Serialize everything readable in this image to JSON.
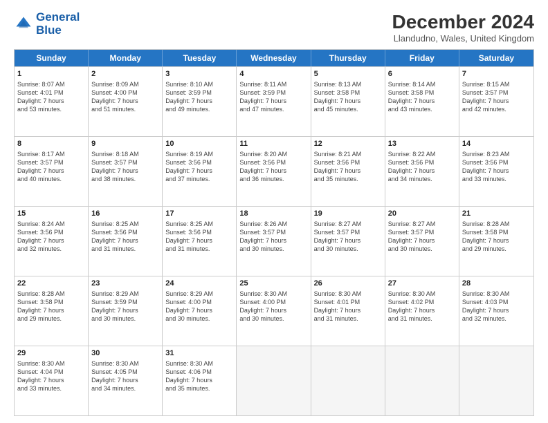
{
  "logo": {
    "line1": "General",
    "line2": "Blue"
  },
  "title": "December 2024",
  "subtitle": "Llandudno, Wales, United Kingdom",
  "header_days": [
    "Sunday",
    "Monday",
    "Tuesday",
    "Wednesday",
    "Thursday",
    "Friday",
    "Saturday"
  ],
  "weeks": [
    [
      {
        "day": "1",
        "lines": [
          "Sunrise: 8:07 AM",
          "Sunset: 4:01 PM",
          "Daylight: 7 hours",
          "and 53 minutes."
        ]
      },
      {
        "day": "2",
        "lines": [
          "Sunrise: 8:09 AM",
          "Sunset: 4:00 PM",
          "Daylight: 7 hours",
          "and 51 minutes."
        ]
      },
      {
        "day": "3",
        "lines": [
          "Sunrise: 8:10 AM",
          "Sunset: 3:59 PM",
          "Daylight: 7 hours",
          "and 49 minutes."
        ]
      },
      {
        "day": "4",
        "lines": [
          "Sunrise: 8:11 AM",
          "Sunset: 3:59 PM",
          "Daylight: 7 hours",
          "and 47 minutes."
        ]
      },
      {
        "day": "5",
        "lines": [
          "Sunrise: 8:13 AM",
          "Sunset: 3:58 PM",
          "Daylight: 7 hours",
          "and 45 minutes."
        ]
      },
      {
        "day": "6",
        "lines": [
          "Sunrise: 8:14 AM",
          "Sunset: 3:58 PM",
          "Daylight: 7 hours",
          "and 43 minutes."
        ]
      },
      {
        "day": "7",
        "lines": [
          "Sunrise: 8:15 AM",
          "Sunset: 3:57 PM",
          "Daylight: 7 hours",
          "and 42 minutes."
        ]
      }
    ],
    [
      {
        "day": "8",
        "lines": [
          "Sunrise: 8:17 AM",
          "Sunset: 3:57 PM",
          "Daylight: 7 hours",
          "and 40 minutes."
        ]
      },
      {
        "day": "9",
        "lines": [
          "Sunrise: 8:18 AM",
          "Sunset: 3:57 PM",
          "Daylight: 7 hours",
          "and 38 minutes."
        ]
      },
      {
        "day": "10",
        "lines": [
          "Sunrise: 8:19 AM",
          "Sunset: 3:56 PM",
          "Daylight: 7 hours",
          "and 37 minutes."
        ]
      },
      {
        "day": "11",
        "lines": [
          "Sunrise: 8:20 AM",
          "Sunset: 3:56 PM",
          "Daylight: 7 hours",
          "and 36 minutes."
        ]
      },
      {
        "day": "12",
        "lines": [
          "Sunrise: 8:21 AM",
          "Sunset: 3:56 PM",
          "Daylight: 7 hours",
          "and 35 minutes."
        ]
      },
      {
        "day": "13",
        "lines": [
          "Sunrise: 8:22 AM",
          "Sunset: 3:56 PM",
          "Daylight: 7 hours",
          "and 34 minutes."
        ]
      },
      {
        "day": "14",
        "lines": [
          "Sunrise: 8:23 AM",
          "Sunset: 3:56 PM",
          "Daylight: 7 hours",
          "and 33 minutes."
        ]
      }
    ],
    [
      {
        "day": "15",
        "lines": [
          "Sunrise: 8:24 AM",
          "Sunset: 3:56 PM",
          "Daylight: 7 hours",
          "and 32 minutes."
        ]
      },
      {
        "day": "16",
        "lines": [
          "Sunrise: 8:25 AM",
          "Sunset: 3:56 PM",
          "Daylight: 7 hours",
          "and 31 minutes."
        ]
      },
      {
        "day": "17",
        "lines": [
          "Sunrise: 8:25 AM",
          "Sunset: 3:56 PM",
          "Daylight: 7 hours",
          "and 31 minutes."
        ]
      },
      {
        "day": "18",
        "lines": [
          "Sunrise: 8:26 AM",
          "Sunset: 3:57 PM",
          "Daylight: 7 hours",
          "and 30 minutes."
        ]
      },
      {
        "day": "19",
        "lines": [
          "Sunrise: 8:27 AM",
          "Sunset: 3:57 PM",
          "Daylight: 7 hours",
          "and 30 minutes."
        ]
      },
      {
        "day": "20",
        "lines": [
          "Sunrise: 8:27 AM",
          "Sunset: 3:57 PM",
          "Daylight: 7 hours",
          "and 30 minutes."
        ]
      },
      {
        "day": "21",
        "lines": [
          "Sunrise: 8:28 AM",
          "Sunset: 3:58 PM",
          "Daylight: 7 hours",
          "and 29 minutes."
        ]
      }
    ],
    [
      {
        "day": "22",
        "lines": [
          "Sunrise: 8:28 AM",
          "Sunset: 3:58 PM",
          "Daylight: 7 hours",
          "and 29 minutes."
        ]
      },
      {
        "day": "23",
        "lines": [
          "Sunrise: 8:29 AM",
          "Sunset: 3:59 PM",
          "Daylight: 7 hours",
          "and 30 minutes."
        ]
      },
      {
        "day": "24",
        "lines": [
          "Sunrise: 8:29 AM",
          "Sunset: 4:00 PM",
          "Daylight: 7 hours",
          "and 30 minutes."
        ]
      },
      {
        "day": "25",
        "lines": [
          "Sunrise: 8:30 AM",
          "Sunset: 4:00 PM",
          "Daylight: 7 hours",
          "and 30 minutes."
        ]
      },
      {
        "day": "26",
        "lines": [
          "Sunrise: 8:30 AM",
          "Sunset: 4:01 PM",
          "Daylight: 7 hours",
          "and 31 minutes."
        ]
      },
      {
        "day": "27",
        "lines": [
          "Sunrise: 8:30 AM",
          "Sunset: 4:02 PM",
          "Daylight: 7 hours",
          "and 31 minutes."
        ]
      },
      {
        "day": "28",
        "lines": [
          "Sunrise: 8:30 AM",
          "Sunset: 4:03 PM",
          "Daylight: 7 hours",
          "and 32 minutes."
        ]
      }
    ],
    [
      {
        "day": "29",
        "lines": [
          "Sunrise: 8:30 AM",
          "Sunset: 4:04 PM",
          "Daylight: 7 hours",
          "and 33 minutes."
        ]
      },
      {
        "day": "30",
        "lines": [
          "Sunrise: 8:30 AM",
          "Sunset: 4:05 PM",
          "Daylight: 7 hours",
          "and 34 minutes."
        ]
      },
      {
        "day": "31",
        "lines": [
          "Sunrise: 8:30 AM",
          "Sunset: 4:06 PM",
          "Daylight: 7 hours",
          "and 35 minutes."
        ]
      },
      null,
      null,
      null,
      null
    ]
  ]
}
